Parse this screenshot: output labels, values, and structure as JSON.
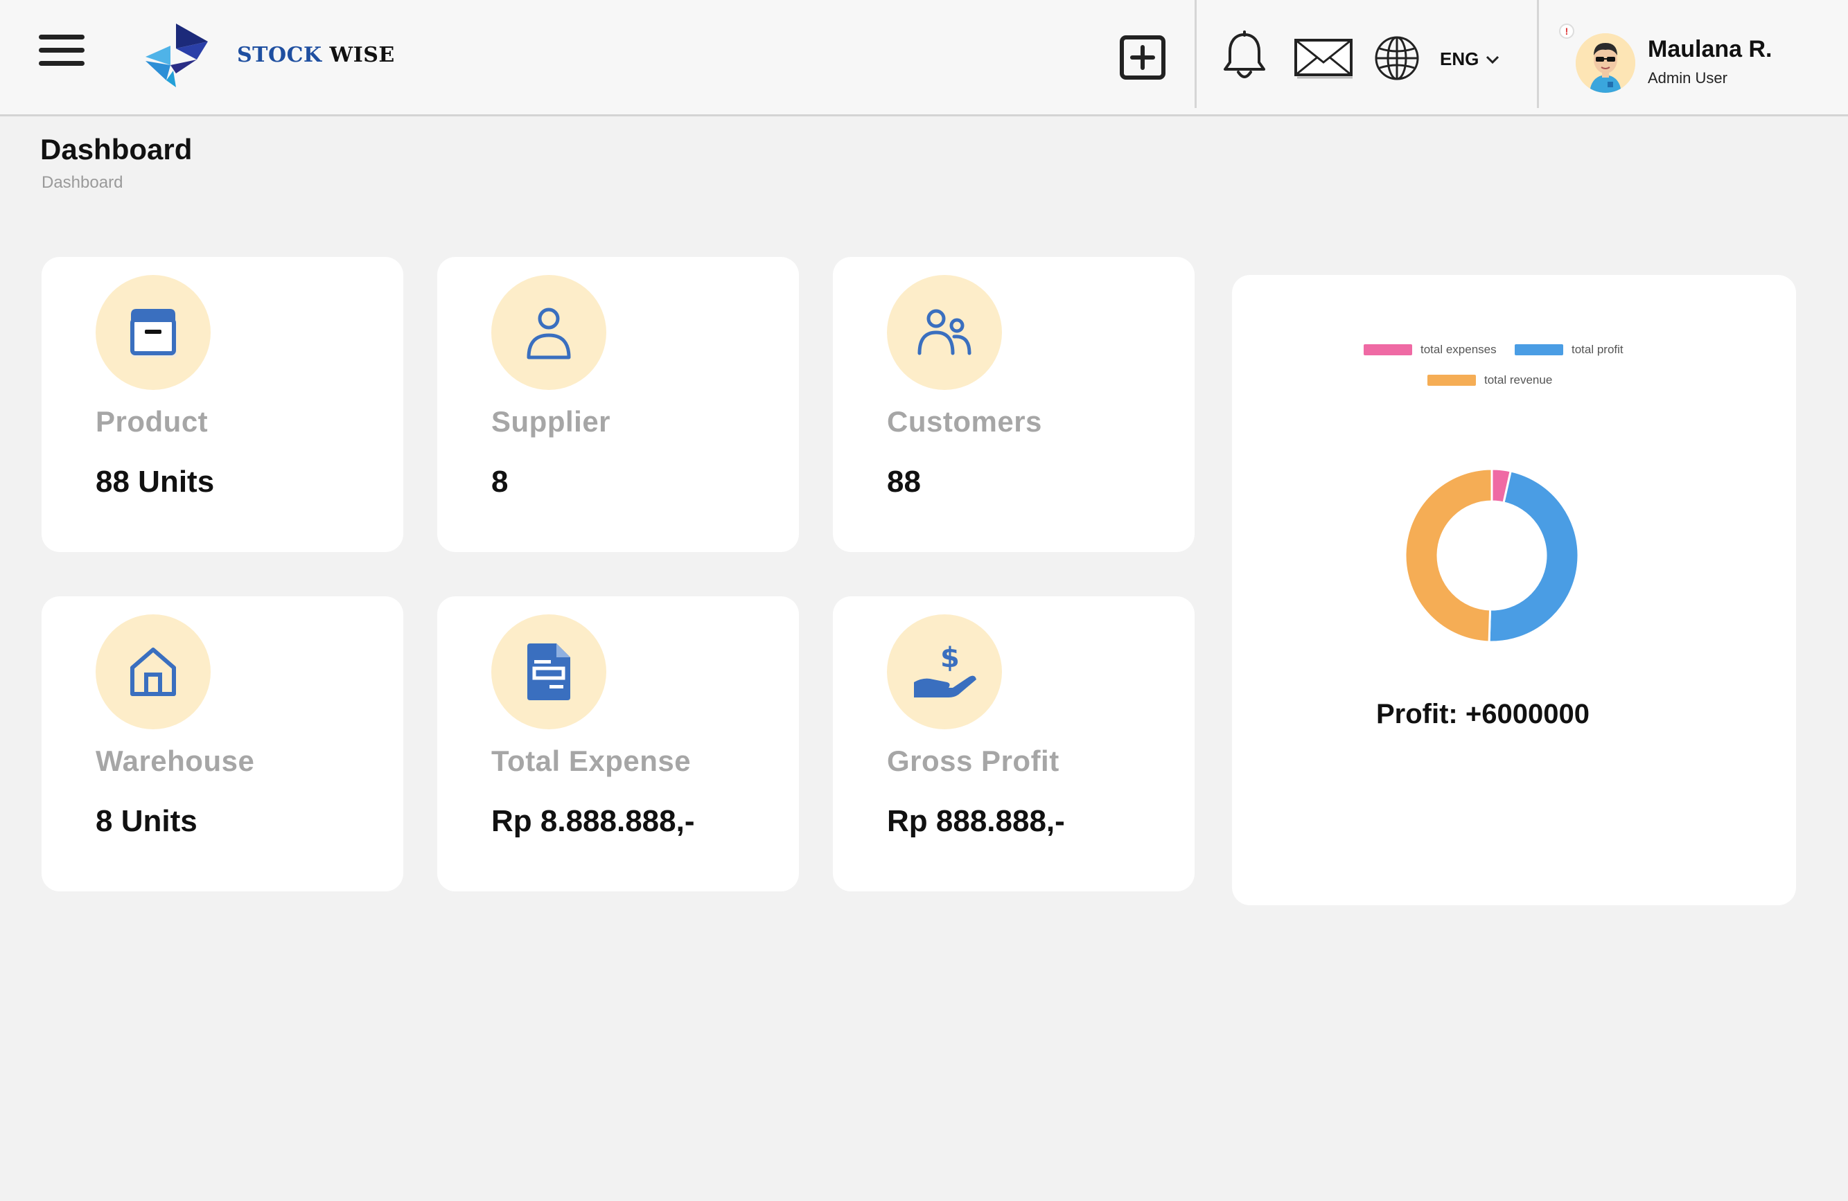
{
  "header": {
    "brand_part1": "STOCK",
    "brand_part2": "WISE",
    "language": "ENG",
    "notification_count": "!",
    "user_name": "Maulana  R.",
    "user_role": "Admin  User"
  },
  "page": {
    "title": "Dashboard",
    "breadcrumb": "Dashboard"
  },
  "cards": [
    {
      "label": "Product",
      "value": "88  Units",
      "icon": "box-icon"
    },
    {
      "label": "Supplier",
      "value": "8",
      "icon": "user-icon"
    },
    {
      "label": "Customers",
      "value": "88",
      "icon": "users-icon"
    },
    {
      "label": "Warehouse",
      "value": "8  Units",
      "icon": "home-icon"
    },
    {
      "label": "Total  Expense",
      "value": "Rp  8.888.888,-",
      "icon": "document-icon"
    },
    {
      "label": "Gross  Profit",
      "value": "Rp  888.888,-",
      "icon": "hand-dollar-icon"
    }
  ],
  "chart_data": {
    "type": "pie",
    "variant": "doughnut",
    "legend": [
      {
        "name": "total expenses",
        "color": "#ef6aa4"
      },
      {
        "name": "total profit",
        "color": "#4a9de4"
      },
      {
        "name": "total revenue",
        "color": "#f5ad55"
      }
    ],
    "values": [
      3.5,
      47,
      49.5
    ],
    "legend_position": "top",
    "caption": "Profit:  +6000000"
  },
  "colors": {
    "accent_blue": "#3a6fbf",
    "icon_circle": "#fdedc9",
    "background": "#f2f2f2"
  }
}
